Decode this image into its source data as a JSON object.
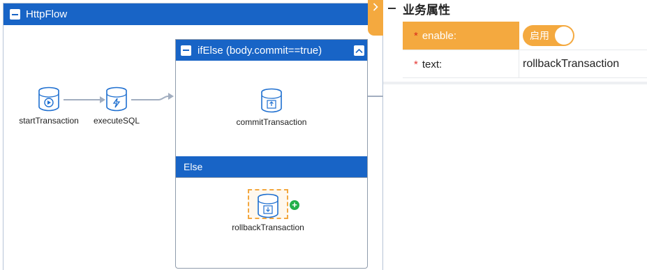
{
  "flow": {
    "title": "HttpFlow",
    "nodes": {
      "start": {
        "label": "startTransaction",
        "icon": "db-play-icon"
      },
      "execute": {
        "label": "executeSQL",
        "icon": "db-lightning-icon"
      },
      "commit": {
        "label": "commitTransaction",
        "icon": "db-commit-icon"
      },
      "rollback": {
        "label": "rollbackTransaction",
        "icon": "db-rollback-icon"
      }
    },
    "ifelse": {
      "title": "ifElse (body.commit==true)",
      "else_label": "Else"
    }
  },
  "panel": {
    "title": "业务属性",
    "properties": {
      "enable": {
        "label": "enable:",
        "switch_text": "启用",
        "on": true
      },
      "text": {
        "label": "text:",
        "value": "rollbackTransaction"
      }
    }
  },
  "colors": {
    "header_blue": "#1864c6",
    "accent_orange": "#f4a93f",
    "icon_blue": "#1e6fd0",
    "add_green": "#22b04a"
  }
}
